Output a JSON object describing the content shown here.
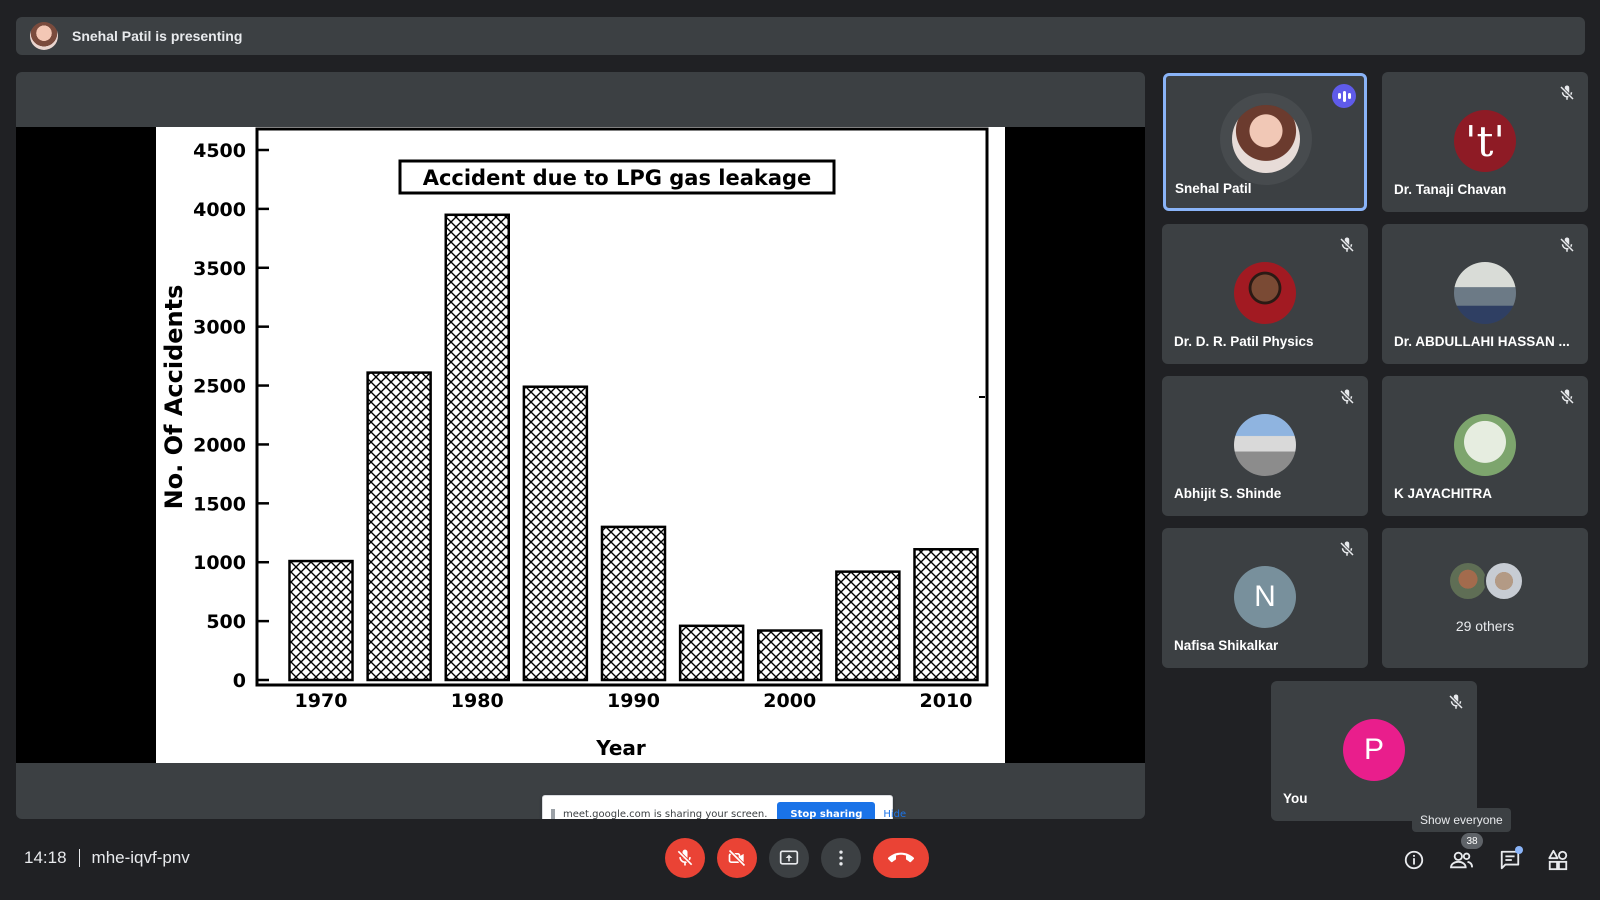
{
  "presenter_bar": {
    "text": "Snehal Patil is presenting"
  },
  "chart_data": {
    "type": "bar",
    "title": "Accident due to LPG gas leakage",
    "ylabel": "No. Of Accidents",
    "xlabel": "Year",
    "x": [
      1970,
      1975,
      1980,
      1985,
      1990,
      1995,
      2000,
      2005,
      2010
    ],
    "values": [
      1010,
      2610,
      3950,
      2490,
      1300,
      460,
      420,
      920,
      1110
    ],
    "ylim": [
      0,
      4500
    ],
    "yticks": [
      0,
      500,
      1000,
      1500,
      2000,
      2500,
      3000,
      3500,
      4000,
      4500
    ],
    "xticks": [
      1970,
      1980,
      1990,
      2000,
      2010
    ],
    "grid": false,
    "bar_pattern": "crosshatch"
  },
  "share_notice": {
    "text": "meet.google.com is sharing your screen.",
    "stop_label": "Stop sharing",
    "hide_label": "Hide"
  },
  "participants": [
    {
      "name": "Snehal Patil",
      "speaking": true
    },
    {
      "name": "Dr. Tanaji Chavan",
      "initial": "'t'",
      "color": "#8e1b25",
      "muted": true
    },
    {
      "name": "Dr. D. R. Patil Physics",
      "muted": true
    },
    {
      "name": "Dr. ABDULLAHI HASSAN ...",
      "muted": true
    },
    {
      "name": "Abhijit S. Shinde",
      "muted": true
    },
    {
      "name": "K JAYACHITRA",
      "muted": true
    },
    {
      "name": "Nafisa Shikalkar",
      "initial": "N",
      "color": "#78909c",
      "muted": true
    },
    {
      "name": "29 others"
    },
    {
      "name": "You",
      "initial": "P",
      "color": "#e91e8c",
      "muted": true
    }
  ],
  "bottom_bar": {
    "time": "14:18",
    "meeting_code": "mhe-iqvf-pnv",
    "participant_count": "38",
    "tooltip": "Show everyone"
  },
  "colors": {
    "background": "#202124",
    "tile": "#3c4043",
    "danger": "#ea4335",
    "accent": "#8ab4f8",
    "speaking": "#5f5bea"
  },
  "icons": {
    "mic": "mic-off-icon",
    "camera": "camera-off-icon",
    "present": "present-screen-icon",
    "more": "more-options-icon",
    "leave": "hang-up-icon",
    "info": "info-icon",
    "people": "people-icon",
    "chat": "chat-icon",
    "activities": "activities-icon"
  }
}
